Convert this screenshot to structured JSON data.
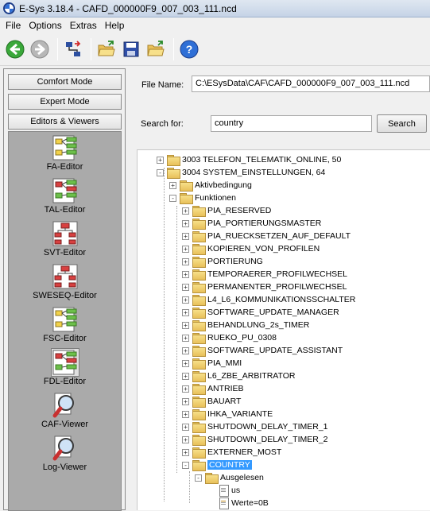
{
  "window": {
    "title": "E-Sys 3.18.4 - CAFD_000000F9_007_003_111.ncd"
  },
  "menu": [
    "File",
    "Options",
    "Extras",
    "Help"
  ],
  "toolbar": {
    "back_icon": "back-arrow-icon",
    "forward_icon": "forward-arrow-icon",
    "connect_icon": "connect-icon",
    "open_icon": "open-folder-icon",
    "save_icon": "save-icon",
    "open2_icon": "open-folder-icon",
    "help_icon": "help-icon"
  },
  "left": {
    "modes": [
      "Comfort Mode",
      "Expert Mode",
      "Editors & Viewers"
    ],
    "tools": [
      {
        "label": "FA-Editor",
        "icon": "fa-editor-icon"
      },
      {
        "label": "TAL-Editor",
        "icon": "tal-editor-icon"
      },
      {
        "label": "SVT-Editor",
        "icon": "svt-editor-icon"
      },
      {
        "label": "SWESEQ-Editor",
        "icon": "sweseq-editor-icon"
      },
      {
        "label": "FSC-Editor",
        "icon": "fsc-editor-icon"
      },
      {
        "label": "FDL-Editor",
        "icon": "fdl-editor-icon",
        "selected": true
      },
      {
        "label": "CAF-Viewer",
        "icon": "caf-viewer-icon"
      },
      {
        "label": "Log-Viewer",
        "icon": "log-viewer-icon"
      }
    ]
  },
  "file": {
    "label": "File Name:",
    "value": "C:\\ESysData\\CAF\\CAFD_000000F9_007_003_111.ncd"
  },
  "search": {
    "label": "Search for:",
    "value": "country",
    "button": "Search"
  },
  "tree": [
    {
      "text": "3003 TELEFON_TELEMATIK_ONLINE, 50",
      "level": 0,
      "exp": "+"
    },
    {
      "text": "3004 SYSTEM_EINSTELLUNGEN, 64",
      "level": 0,
      "exp": "-"
    },
    {
      "text": "Aktivbedingung",
      "level": 1,
      "exp": "+"
    },
    {
      "text": "Funktionen",
      "level": 1,
      "exp": "-"
    },
    {
      "text": "PIA_RESERVED",
      "level": 2,
      "exp": "+"
    },
    {
      "text": "PIA_PORTIERUNGSMASTER",
      "level": 2,
      "exp": "+"
    },
    {
      "text": "PIA_RUECKSETZEN_AUF_DEFAULT",
      "level": 2,
      "exp": "+"
    },
    {
      "text": "KOPIEREN_VON_PROFILEN",
      "level": 2,
      "exp": "+"
    },
    {
      "text": "PORTIERUNG",
      "level": 2,
      "exp": "+"
    },
    {
      "text": "TEMPORAERER_PROFILWECHSEL",
      "level": 2,
      "exp": "+"
    },
    {
      "text": "PERMANENTER_PROFILWECHSEL",
      "level": 2,
      "exp": "+"
    },
    {
      "text": "L4_L6_KOMMUNIKATIONSSCHALTER",
      "level": 2,
      "exp": "+"
    },
    {
      "text": "SOFTWARE_UPDATE_MANAGER",
      "level": 2,
      "exp": "+"
    },
    {
      "text": "BEHANDLUNG_2s_TIMER",
      "level": 2,
      "exp": "+"
    },
    {
      "text": "RUEKO_PU_0308",
      "level": 2,
      "exp": "+"
    },
    {
      "text": "SOFTWARE_UPDATE_ASSISTANT",
      "level": 2,
      "exp": "+"
    },
    {
      "text": "PIA_MMI",
      "level": 2,
      "exp": "+"
    },
    {
      "text": "L6_ZBE_ARBITRATOR",
      "level": 2,
      "exp": "+"
    },
    {
      "text": "ANTRIEB",
      "level": 2,
      "exp": "+"
    },
    {
      "text": "BAUART",
      "level": 2,
      "exp": "+"
    },
    {
      "text": "IHKA_VARIANTE",
      "level": 2,
      "exp": "+"
    },
    {
      "text": "SHUTDOWN_DELAY_TIMER_1",
      "level": 2,
      "exp": "+"
    },
    {
      "text": "SHUTDOWN_DELAY_TIMER_2",
      "level": 2,
      "exp": "+"
    },
    {
      "text": "EXTERNER_MOST",
      "level": 2,
      "exp": "+"
    },
    {
      "text": "COUNTRY",
      "level": 2,
      "exp": "-",
      "selected": true
    },
    {
      "text": "Ausgelesen",
      "level": 3,
      "exp": "-"
    },
    {
      "text": "us",
      "level": 4,
      "leaf": true
    },
    {
      "text": "Werte=0B",
      "level": 4,
      "leaf": true,
      "edit": true
    }
  ]
}
